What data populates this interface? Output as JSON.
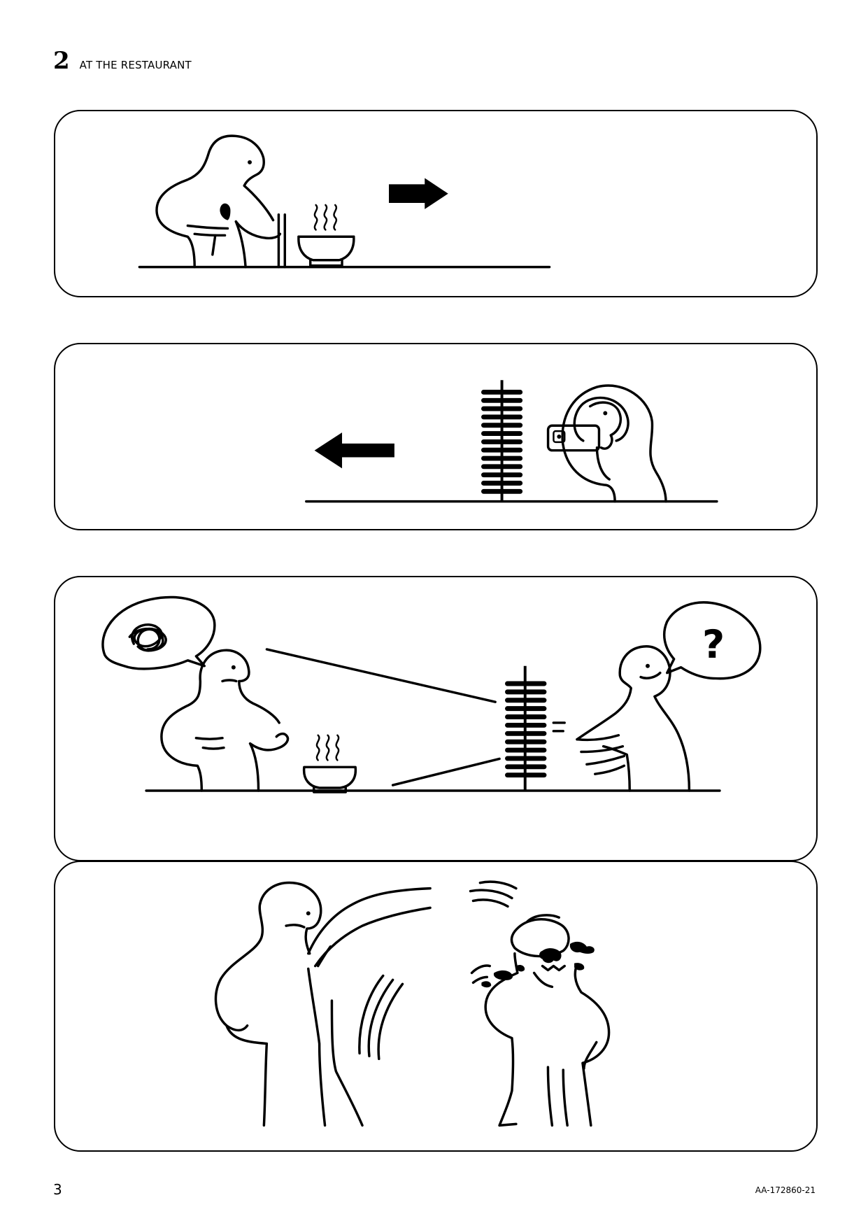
{
  "header": {
    "step_number": "2",
    "step_title": "AT THE RESTAURANT"
  },
  "panels": [
    {
      "id": "panel-1",
      "icon": "arrow-right-icon"
    },
    {
      "id": "panel-2",
      "icon": "arrow-left-icon"
    },
    {
      "id": "panel-3",
      "thought_left_icon": "scribble-thought-icon",
      "thought_right_symbol": "?"
    },
    {
      "id": "panel-4"
    }
  ],
  "footer": {
    "page_number": "3",
    "doc_code": "AA-172860-21"
  }
}
